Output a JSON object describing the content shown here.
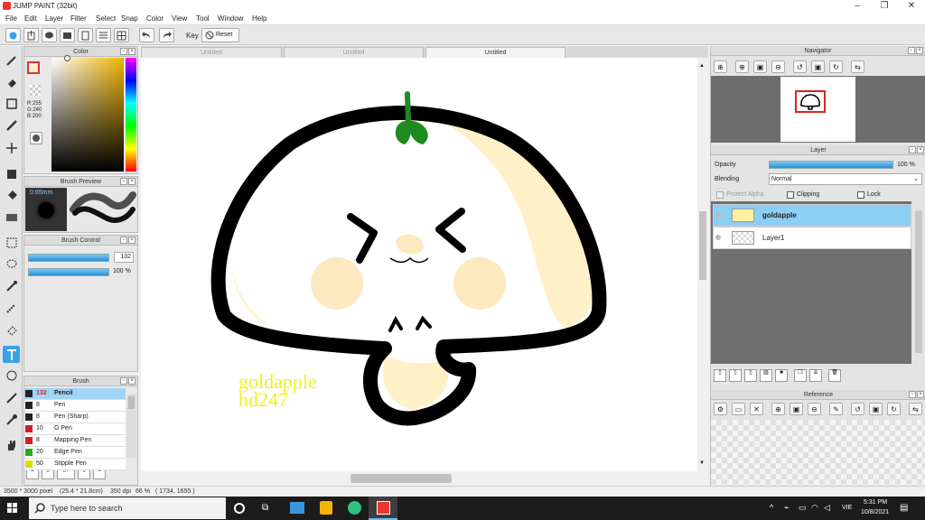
{
  "app": {
    "title": "JUMP PAINT (32bit)"
  },
  "menu": [
    "File",
    "Edit",
    "Layer",
    "Filter",
    "Select",
    "Snap",
    "Color",
    "View",
    "Tool",
    "Window",
    "Help"
  ],
  "toolbar": {
    "key_label": "Key",
    "reset_label": "Reset"
  },
  "color_panel": {
    "title": "Color",
    "r": "R:255",
    "g": "G:240",
    "b": "B:200"
  },
  "brush_preview": {
    "title": "Brush Preview",
    "size": "0.65mm"
  },
  "brush_control": {
    "title": "Brush Control",
    "size_value": "132",
    "opacity_value": "100 %"
  },
  "brush_panel": {
    "title": "Brush",
    "items": [
      {
        "size": "132",
        "name": "Pencil",
        "color": "#222222"
      },
      {
        "size": "8",
        "name": "Pen",
        "color": "#222222"
      },
      {
        "size": "8",
        "name": "Pen (Sharp)",
        "color": "#222222"
      },
      {
        "size": "10",
        "name": "G Pen",
        "color": "#d62020"
      },
      {
        "size": "8",
        "name": "Mapping Pen",
        "color": "#d62020"
      },
      {
        "size": "20",
        "name": "Edge Pen",
        "color": "#22aa22"
      },
      {
        "size": "50",
        "name": "Stipple Pen",
        "color": "#dddd00"
      }
    ]
  },
  "doc_tabs": [
    "Untitled",
    "Untitled",
    "Untitled"
  ],
  "canvas": {
    "watermark_line1": "goldapple",
    "watermark_line2": "hd247"
  },
  "navigator": {
    "title": "Navigator"
  },
  "layer_panel": {
    "title": "Layer",
    "opacity_label": "Opacity",
    "opacity_value": "100 %",
    "blending_label": "Blending",
    "blending_value": "Normal",
    "protect_alpha": "Protect Alpha",
    "clipping": "Clipping",
    "lock": "Lock",
    "layers": [
      {
        "name": "goldapple",
        "selected": true
      },
      {
        "name": "Layer1",
        "selected": false
      }
    ]
  },
  "reference": {
    "title": "Reference"
  },
  "status": {
    "dims": "3500 * 3000 pixel",
    "physical": "(25.4 * 21.8cm)",
    "dpi": "350 dpi",
    "zoom": "66 %",
    "coords": "( 1734, 1655 )"
  },
  "taskbar": {
    "search_placeholder": "Type here to search",
    "time": "5:31 PM",
    "date": "10/8/2021",
    "lang": "VIE"
  },
  "colors": {
    "accent": "#3aa0e8",
    "skin": "#fff0c8",
    "blush": "#fde9c0",
    "leaf": "#1f8a1f",
    "watermark": "#f4ef1c"
  }
}
